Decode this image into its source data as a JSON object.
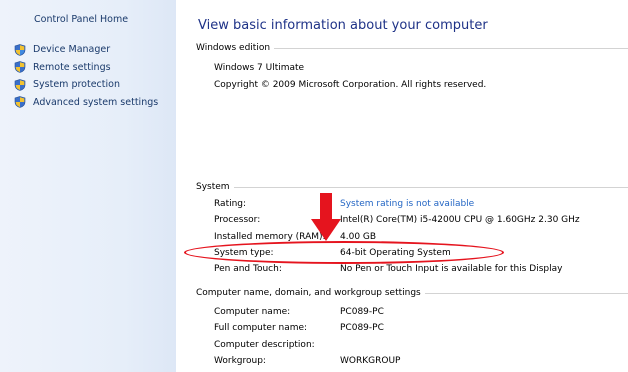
{
  "sidebar": {
    "home_label": "Control Panel Home",
    "items": [
      {
        "label": "Device Manager",
        "icon": "shield-icon"
      },
      {
        "label": "Remote settings",
        "icon": "shield-icon"
      },
      {
        "label": "System protection",
        "icon": "shield-icon"
      },
      {
        "label": "Advanced system settings",
        "icon": "shield-icon"
      }
    ]
  },
  "main": {
    "title": "View basic information about your computer",
    "edition": {
      "header": "Windows edition",
      "name": "Windows 7 Ultimate",
      "copyright": "Copyright © 2009 Microsoft Corporation.  All rights reserved."
    },
    "system": {
      "header": "System",
      "rows": [
        {
          "label": "Rating:",
          "value": "System rating is not available"
        },
        {
          "label": "Processor:",
          "value": "Intel(R) Core(TM) i5-4200U CPU @ 1.60GHz   2.30 GHz"
        },
        {
          "label": "Installed memory (RAM):",
          "value": "4.00 GB"
        },
        {
          "label": "System type:",
          "value": "64-bit Operating System"
        },
        {
          "label": "Pen and Touch:",
          "value": "No Pen or Touch Input is available for this Display"
        }
      ]
    },
    "computer": {
      "header": "Computer name, domain, and workgroup settings",
      "rows": [
        {
          "label": "Computer name:",
          "value": "PC089-PC"
        },
        {
          "label": "Full computer name:",
          "value": "PC089-PC"
        },
        {
          "label": "Computer description:",
          "value": ""
        },
        {
          "label": "Workgroup:",
          "value": "WORKGROUP"
        }
      ]
    }
  },
  "colors": {
    "highlight": "#e5141e",
    "link": "#2466c4",
    "title": "#1e3287"
  }
}
